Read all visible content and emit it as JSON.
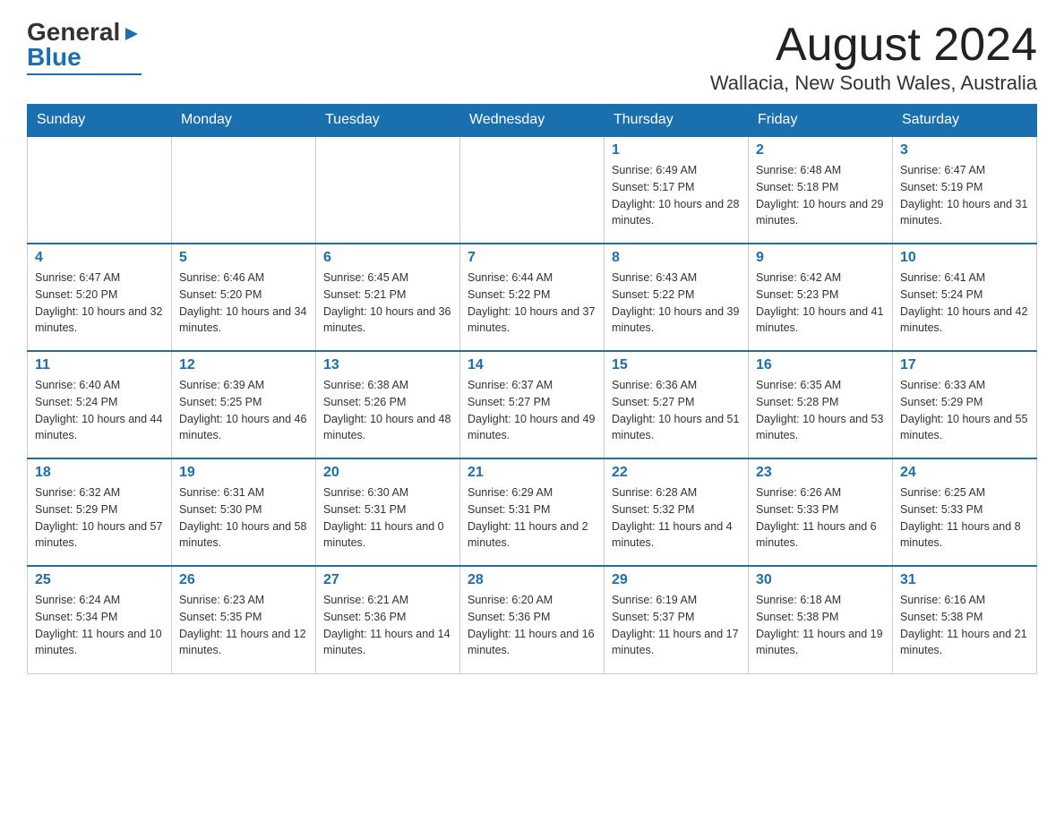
{
  "header": {
    "logo": {
      "text_general": "General",
      "text_blue": "Blue",
      "tagline": ""
    },
    "title": "August 2024",
    "subtitle": "Wallacia, New South Wales, Australia"
  },
  "calendar": {
    "days_of_week": [
      "Sunday",
      "Monday",
      "Tuesday",
      "Wednesday",
      "Thursday",
      "Friday",
      "Saturday"
    ],
    "weeks": [
      [
        {
          "num": "",
          "info": ""
        },
        {
          "num": "",
          "info": ""
        },
        {
          "num": "",
          "info": ""
        },
        {
          "num": "",
          "info": ""
        },
        {
          "num": "1",
          "info": "Sunrise: 6:49 AM\nSunset: 5:17 PM\nDaylight: 10 hours and 28 minutes."
        },
        {
          "num": "2",
          "info": "Sunrise: 6:48 AM\nSunset: 5:18 PM\nDaylight: 10 hours and 29 minutes."
        },
        {
          "num": "3",
          "info": "Sunrise: 6:47 AM\nSunset: 5:19 PM\nDaylight: 10 hours and 31 minutes."
        }
      ],
      [
        {
          "num": "4",
          "info": "Sunrise: 6:47 AM\nSunset: 5:20 PM\nDaylight: 10 hours and 32 minutes."
        },
        {
          "num": "5",
          "info": "Sunrise: 6:46 AM\nSunset: 5:20 PM\nDaylight: 10 hours and 34 minutes."
        },
        {
          "num": "6",
          "info": "Sunrise: 6:45 AM\nSunset: 5:21 PM\nDaylight: 10 hours and 36 minutes."
        },
        {
          "num": "7",
          "info": "Sunrise: 6:44 AM\nSunset: 5:22 PM\nDaylight: 10 hours and 37 minutes."
        },
        {
          "num": "8",
          "info": "Sunrise: 6:43 AM\nSunset: 5:22 PM\nDaylight: 10 hours and 39 minutes."
        },
        {
          "num": "9",
          "info": "Sunrise: 6:42 AM\nSunset: 5:23 PM\nDaylight: 10 hours and 41 minutes."
        },
        {
          "num": "10",
          "info": "Sunrise: 6:41 AM\nSunset: 5:24 PM\nDaylight: 10 hours and 42 minutes."
        }
      ],
      [
        {
          "num": "11",
          "info": "Sunrise: 6:40 AM\nSunset: 5:24 PM\nDaylight: 10 hours and 44 minutes."
        },
        {
          "num": "12",
          "info": "Sunrise: 6:39 AM\nSunset: 5:25 PM\nDaylight: 10 hours and 46 minutes."
        },
        {
          "num": "13",
          "info": "Sunrise: 6:38 AM\nSunset: 5:26 PM\nDaylight: 10 hours and 48 minutes."
        },
        {
          "num": "14",
          "info": "Sunrise: 6:37 AM\nSunset: 5:27 PM\nDaylight: 10 hours and 49 minutes."
        },
        {
          "num": "15",
          "info": "Sunrise: 6:36 AM\nSunset: 5:27 PM\nDaylight: 10 hours and 51 minutes."
        },
        {
          "num": "16",
          "info": "Sunrise: 6:35 AM\nSunset: 5:28 PM\nDaylight: 10 hours and 53 minutes."
        },
        {
          "num": "17",
          "info": "Sunrise: 6:33 AM\nSunset: 5:29 PM\nDaylight: 10 hours and 55 minutes."
        }
      ],
      [
        {
          "num": "18",
          "info": "Sunrise: 6:32 AM\nSunset: 5:29 PM\nDaylight: 10 hours and 57 minutes."
        },
        {
          "num": "19",
          "info": "Sunrise: 6:31 AM\nSunset: 5:30 PM\nDaylight: 10 hours and 58 minutes."
        },
        {
          "num": "20",
          "info": "Sunrise: 6:30 AM\nSunset: 5:31 PM\nDaylight: 11 hours and 0 minutes."
        },
        {
          "num": "21",
          "info": "Sunrise: 6:29 AM\nSunset: 5:31 PM\nDaylight: 11 hours and 2 minutes."
        },
        {
          "num": "22",
          "info": "Sunrise: 6:28 AM\nSunset: 5:32 PM\nDaylight: 11 hours and 4 minutes."
        },
        {
          "num": "23",
          "info": "Sunrise: 6:26 AM\nSunset: 5:33 PM\nDaylight: 11 hours and 6 minutes."
        },
        {
          "num": "24",
          "info": "Sunrise: 6:25 AM\nSunset: 5:33 PM\nDaylight: 11 hours and 8 minutes."
        }
      ],
      [
        {
          "num": "25",
          "info": "Sunrise: 6:24 AM\nSunset: 5:34 PM\nDaylight: 11 hours and 10 minutes."
        },
        {
          "num": "26",
          "info": "Sunrise: 6:23 AM\nSunset: 5:35 PM\nDaylight: 11 hours and 12 minutes."
        },
        {
          "num": "27",
          "info": "Sunrise: 6:21 AM\nSunset: 5:36 PM\nDaylight: 11 hours and 14 minutes."
        },
        {
          "num": "28",
          "info": "Sunrise: 6:20 AM\nSunset: 5:36 PM\nDaylight: 11 hours and 16 minutes."
        },
        {
          "num": "29",
          "info": "Sunrise: 6:19 AM\nSunset: 5:37 PM\nDaylight: 11 hours and 17 minutes."
        },
        {
          "num": "30",
          "info": "Sunrise: 6:18 AM\nSunset: 5:38 PM\nDaylight: 11 hours and 19 minutes."
        },
        {
          "num": "31",
          "info": "Sunrise: 6:16 AM\nSunset: 5:38 PM\nDaylight: 11 hours and 21 minutes."
        }
      ]
    ]
  }
}
